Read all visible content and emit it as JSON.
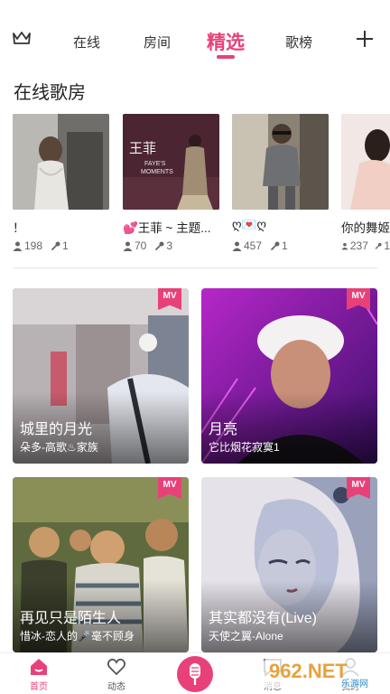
{
  "top_nav": {
    "tabs": [
      {
        "label": "在线"
      },
      {
        "label": "房间"
      },
      {
        "label": "精选"
      },
      {
        "label": "歌榜"
      }
    ],
    "active_tab": "精选",
    "accent_color": "#e8417a"
  },
  "section": {
    "title": "在线歌房"
  },
  "rooms": [
    {
      "name": "！",
      "listeners": "198",
      "singers": "1"
    },
    {
      "name": "💕王菲 ~ 主题...",
      "listeners": "70",
      "singers": "3"
    },
    {
      "name": "ღ💌ღ",
      "listeners": "457",
      "singers": "1"
    },
    {
      "name": "你的舞姬",
      "listeners": "237",
      "singers": "1"
    }
  ],
  "room2_art_text": {
    "line1": "王菲",
    "line2": "FAYE'S",
    "line3": "MOMENTS"
  },
  "mv_cards": [
    {
      "badge": "MV",
      "title": "城里的月光",
      "subtitle": "朵多-高歌♨家族"
    },
    {
      "badge": "MV",
      "title": "月亮",
      "subtitle": "它比烟花寂寞1"
    },
    {
      "badge": "MV",
      "title": "再见只是陌生人",
      "subtitle": "惜冰-恋人的🎤毫不顾身"
    },
    {
      "badge": "MV",
      "title": "其实都没有(Live)",
      "subtitle": "天使之翼-Alone"
    }
  ],
  "bottom_nav": [
    {
      "label": "首页",
      "icon": "home-icon"
    },
    {
      "label": "动态",
      "icon": "heart-icon"
    },
    {
      "label": "",
      "icon": "mic-icon"
    },
    {
      "label": "消息",
      "icon": "message-icon"
    },
    {
      "label": "我的",
      "icon": "profile-icon"
    }
  ],
  "watermark": {
    "text": "962.NET",
    "sub": "乐游网"
  }
}
